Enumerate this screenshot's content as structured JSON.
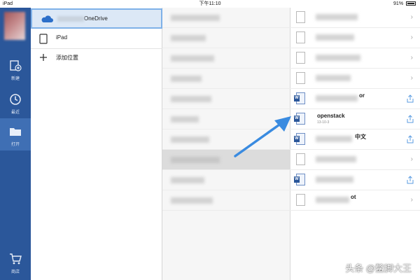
{
  "status_bar": {
    "device": "iPad",
    "time": "下午11:10",
    "battery": "91%"
  },
  "sidebar": {
    "items": [
      {
        "label": "新建",
        "icon": "new-document-icon"
      },
      {
        "label": "最近",
        "icon": "clock-icon"
      },
      {
        "label": "打开",
        "icon": "folder-icon"
      },
      {
        "label": "商店",
        "icon": "cart-icon"
      }
    ]
  },
  "locations": {
    "onedrive_label": "OneDrive",
    "ipad_label": "iPad",
    "add_place_label": "添加位置"
  },
  "files": {
    "partial_name_1": "or",
    "openstack_name": "openstack",
    "openstack_date": "13-10-3",
    "partial_name_2": "中文",
    "partial_name_3": "ot"
  },
  "watermark": "头条 @鳖脚大王",
  "colors": {
    "sidebar": "#2b579a",
    "accent": "#3a8be0",
    "selected": "#dce8f6"
  }
}
